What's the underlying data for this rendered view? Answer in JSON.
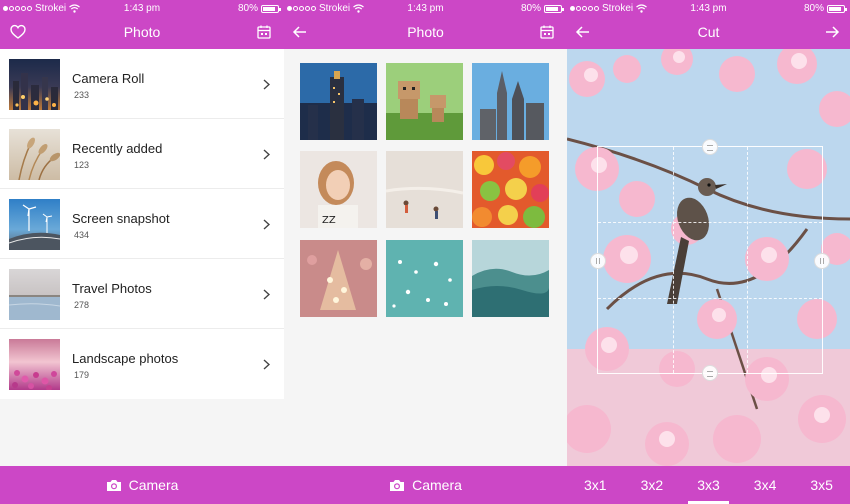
{
  "status": {
    "carrier": "Strokei",
    "time": "1:43 pm",
    "battery": "80%",
    "battery_level": 0.8
  },
  "screen1": {
    "title": "Photo",
    "albums": [
      {
        "name": "Camera Roll",
        "count": "233"
      },
      {
        "name": "Recently added",
        "count": "123"
      },
      {
        "name": "Screen snapshot",
        "count": "434"
      },
      {
        "name": "Travel Photos",
        "count": "278"
      },
      {
        "name": "Landscape photos",
        "count": "179"
      }
    ],
    "tab_label": "Camera"
  },
  "screen2": {
    "title": "Photo",
    "tab_label": "Camera"
  },
  "screen3": {
    "title": "Cut",
    "ratios": [
      "3x1",
      "3x2",
      "3x3",
      "3x4",
      "3x5"
    ],
    "selected_ratio": "3x3"
  },
  "colors": {
    "accent": "#cc47c6"
  },
  "icons": [
    "heart-icon",
    "calendar-icon",
    "back-arrow-icon",
    "forward-arrow-icon",
    "chevron-right-icon",
    "camera-icon",
    "wifi-icon",
    "battery-icon"
  ]
}
